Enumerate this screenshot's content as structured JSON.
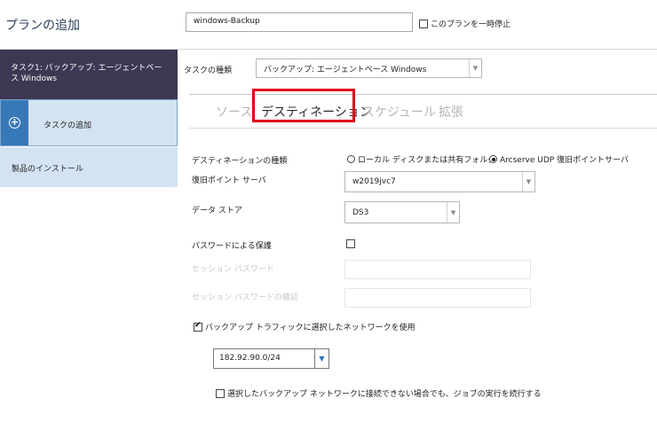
{
  "header": {
    "title": "プランの追加",
    "plan_name_value": "windows-Backup",
    "pause_label": "このプランを一時停止"
  },
  "sidebar": {
    "task_label": "タスク1: バックアップ: エージェントベース Windows",
    "add_task_label": "タスクの追加",
    "install_label": "製品のインストール"
  },
  "task_type": {
    "label": "タスクの種類",
    "value": "バックアップ: エージェントベース Windows"
  },
  "tabs": [
    {
      "label": "ソース",
      "active": false
    },
    {
      "label": "デスティネーション",
      "active": true
    },
    {
      "label": "スケジュール",
      "active": false
    },
    {
      "label": "拡張",
      "active": false
    }
  ],
  "form": {
    "dest_type_label": "デスティネーションの種類",
    "dest_option_local": "ローカル ディスクまたは共有フォルダ",
    "dest_option_rps": "Arcserve UDP 復旧ポイントサーバ",
    "rps_label": "復旧ポイント サーバ",
    "rps_value": "w2019jvc7",
    "datastore_label": "データ ストア",
    "datastore_value": "DS3",
    "password_protect_label": "パスワードによる保護",
    "session_password_label": "セッション パスワード",
    "session_password_confirm_label": "セッション パスワードの確認",
    "network_checkbox_label": "バックアップ トラフィックに選択したネットワークを使用",
    "network_value": "182.92.90.0/24",
    "continue_checkbox_label": "選択したバックアップ ネットワークに接続できない場合でも、ジョブの実行を続行する"
  },
  "colors": {
    "sidebar_active": "#3d3753",
    "sidebar_light": "#d4e3f1",
    "accent_blue": "#3778b8",
    "highlight_red": "#e0001a"
  }
}
